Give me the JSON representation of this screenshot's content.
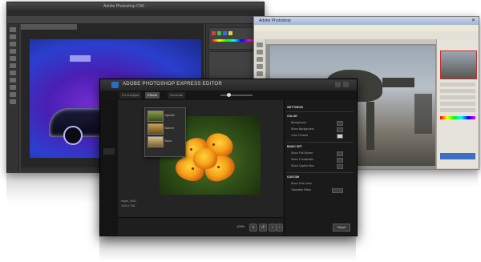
{
  "windows": {
    "dark": {
      "title": "Adobe Photoshop CS6"
    },
    "light": {
      "title": "Adobe Photoshop"
    },
    "express": {
      "title": "ADOBE PHOTOSHOP EXPRESS EDITOR",
      "tabs": [
        "Fix & Adjust",
        "Effects",
        "Decorate"
      ],
      "active_tab": 1,
      "effects_menu": [
        "Vignette",
        "Warmer",
        "Sepia"
      ],
      "panel_title": "SETTINGS",
      "sections": [
        {
          "label": "COLOR",
          "props": [
            "Background",
            "Show Background",
            "Color Presets"
          ]
        },
        {
          "label": "BASIC SET",
          "props": [
            "Show Full Screen",
            "Show Thumbnails",
            "Show Caption Box"
          ]
        },
        {
          "label": "CUSTOM",
          "props": [
            "Show Grid Lines",
            "Transition Effect"
          ]
        }
      ],
      "file_name": "flower_0001",
      "file_size": "1024 x 768",
      "zoom": "100%",
      "finish_label": "Finish"
    }
  },
  "colors": {
    "ps_dark_bg": "#3b3b3b",
    "ps_light_bg": "#d4d0c8",
    "express_bg": "#1e1e1e",
    "accent_blue": "#2a6bc4"
  }
}
